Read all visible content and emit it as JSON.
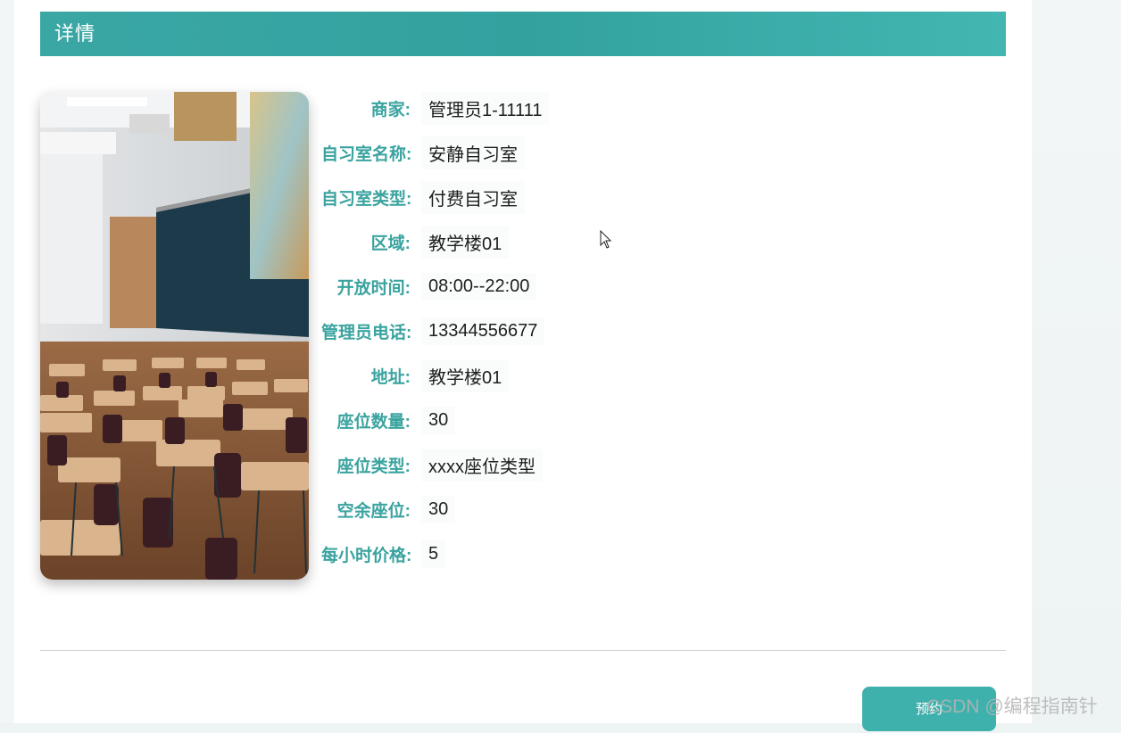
{
  "header": {
    "title": "详情"
  },
  "details": [
    {
      "label": "商家:",
      "value": "管理员1-11111"
    },
    {
      "label": "自习室名称:",
      "value": "安静自习室"
    },
    {
      "label": "自习室类型:",
      "value": "付费自习室"
    },
    {
      "label": "区域:",
      "value": "教学楼01"
    },
    {
      "label": "开放时间:",
      "value": "08:00--22:00"
    },
    {
      "label": "管理员电话:",
      "value": "13344556677"
    },
    {
      "label": "地址:",
      "value": "教学楼01"
    },
    {
      "label": "座位数量:",
      "value": "30"
    },
    {
      "label": "座位类型:",
      "value": "xxxx座位类型"
    },
    {
      "label": "空余座位:",
      "value": "30"
    },
    {
      "label": "每小时价格:",
      "value": "5"
    }
  ],
  "actions": {
    "book_label": "预约"
  },
  "watermark": "CSDN @编程指南针",
  "colors": {
    "accent": "#3aa39f",
    "header_bg": "#36a5a2",
    "button_bg": "#3fb1ad"
  }
}
